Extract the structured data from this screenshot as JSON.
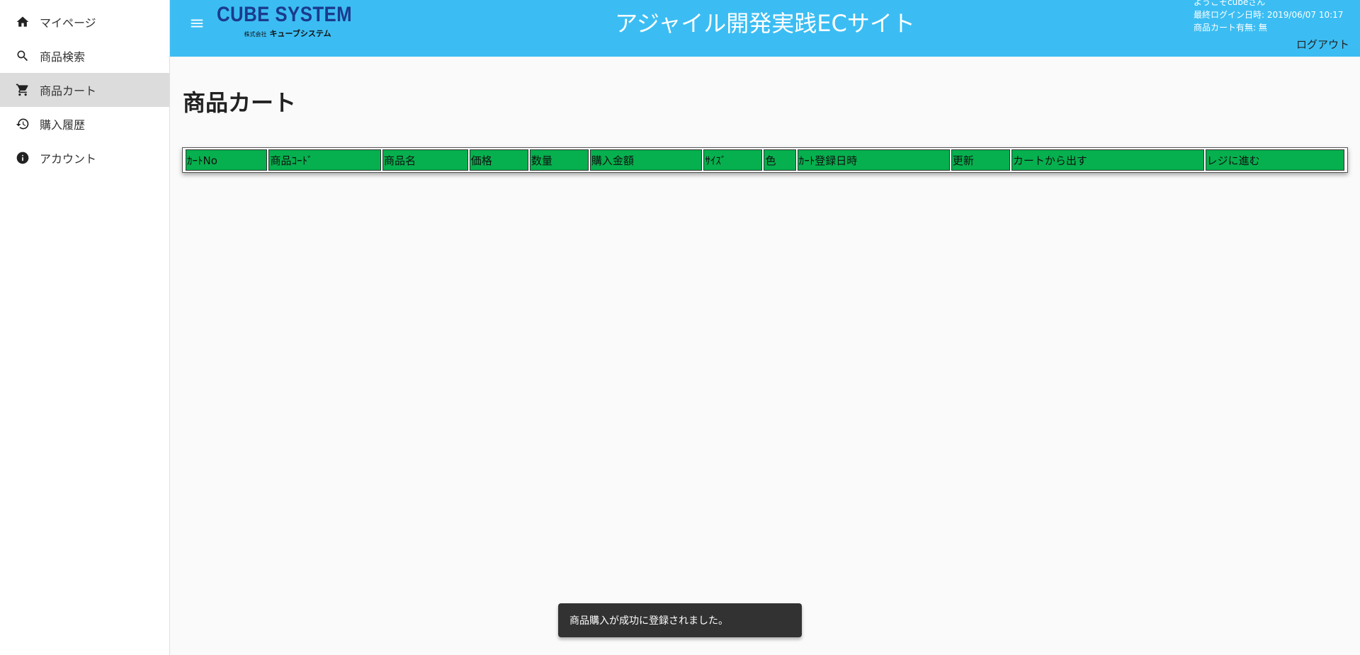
{
  "sidebar": {
    "items": [
      {
        "label": "マイページ",
        "icon": "home-icon"
      },
      {
        "label": "商品検索",
        "icon": "search-icon"
      },
      {
        "label": "商品カート",
        "icon": "cart-icon",
        "active": true
      },
      {
        "label": "購入履歴",
        "icon": "history-icon"
      },
      {
        "label": "アカウント",
        "icon": "info-icon"
      }
    ]
  },
  "header": {
    "logo_main": "CUBE SYSTEM",
    "logo_sub_prefix": "株式会社",
    "logo_sub": "キューブシステム",
    "title": "アジャイル開発実践ECサイト",
    "welcome": "ようこそcubeさん",
    "last_login": "最終ログイン日時: 2019/06/07 10:17",
    "cart_status": "商品カート有無: 無",
    "logout": "ログアウト"
  },
  "main": {
    "page_title": "商品カート",
    "columns": [
      "ｶｰﾄNo",
      "商品ｺｰﾄﾞ",
      "商品名",
      "価格",
      "数量",
      "購入金額",
      "ｻｲｽﾞ",
      "色",
      "ｶｰﾄ登録日時",
      "更新",
      "カートから出す",
      "レジに進む"
    ]
  },
  "toast": {
    "message": "商品購入が成功に登録されました。"
  },
  "colors": {
    "header_bg": "#3bbdf3",
    "table_header_bg": "#06b04e",
    "toast_bg": "#323232"
  }
}
